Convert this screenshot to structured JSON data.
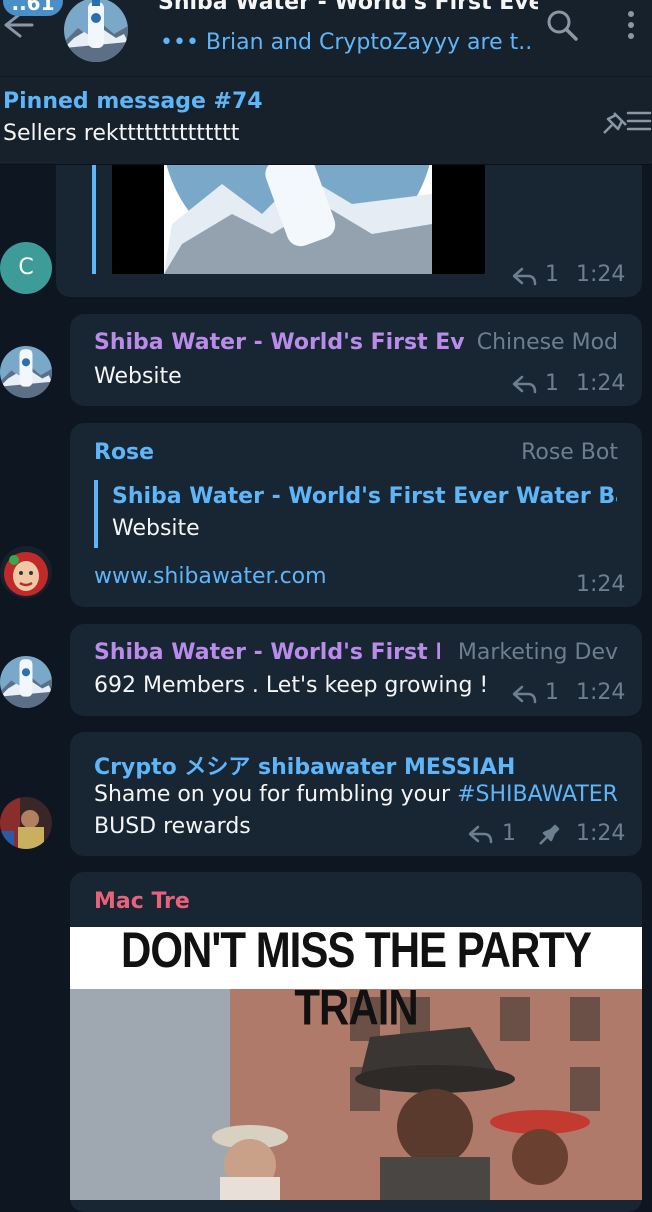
{
  "header": {
    "badge": "..61",
    "title": "Shiba Water - World's First Eve...",
    "status": "••• Brian and CryptoZayyy are t..."
  },
  "pinned": {
    "title": "Pinned message #74",
    "text": "Sellers rektttttttttttttt"
  },
  "messages": [
    {
      "avatar_letter": "C",
      "avatar_color": "#3d9b98",
      "reply_count": "1",
      "time": "1:24"
    },
    {
      "sender": "Shiba Water - World's First Ev...",
      "sender_color": "#b88ce8",
      "role": "Chinese Mod",
      "text": "Website",
      "reply_count": "1",
      "time": "1:24"
    },
    {
      "sender": "Rose",
      "sender_color": "#5eb5f7",
      "role": "Rose Bot",
      "quote_sender": "Shiba Water - World's First Ever Water Bas...",
      "quote_text": "Website",
      "link": "www.shibawater.com",
      "time": "1:24"
    },
    {
      "sender": "Shiba Water - World's First E...",
      "sender_color": "#b88ce8",
      "role": "Marketing Dev",
      "text": "692 Members . Let's keep growing !",
      "reply_count": "1",
      "time": "1:24"
    },
    {
      "sender": "Crypto メシア shibawater MESSIAH",
      "sender_color": "#5eb5f7",
      "text_line1": "Shame on you for fumbling your ",
      "hashtag": "#SHIBAWATER",
      "text_line2": "BUSD rewards",
      "reply_count": "1",
      "time": "1:24"
    },
    {
      "sender": "Mac Tre",
      "sender_color": "#e8637a",
      "gif_caption": "DON'T MISS THE PARTY TRAIN"
    }
  ]
}
